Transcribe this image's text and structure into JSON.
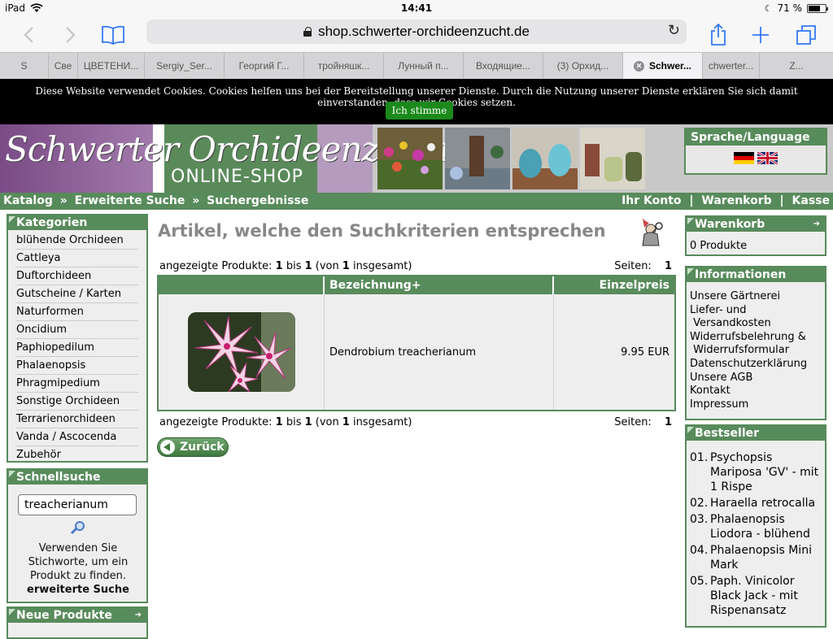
{
  "status_bar": {
    "device": "iPad",
    "time": "14:41",
    "battery": "71 %",
    "battery_level": 0.71
  },
  "toolbar": {
    "url": "shop.schwerter-orchideenzucht.de"
  },
  "tabs": [
    {
      "label": "S",
      "active": false
    },
    {
      "label": "Све",
      "active": false
    },
    {
      "label": "ЦВЕТЕНИ...",
      "active": false
    },
    {
      "label": "Sergiy_Ser...",
      "active": false
    },
    {
      "label": "Георгий Г...",
      "active": false
    },
    {
      "label": "тройняшк...",
      "active": false
    },
    {
      "label": "Лунный п...",
      "active": false
    },
    {
      "label": "Входящие...",
      "active": false
    },
    {
      "label": "(3) Орхид...",
      "active": false
    },
    {
      "label": "Schwer...",
      "active": true
    },
    {
      "label": "chwerter...",
      "active": false
    },
    {
      "label": "Z...",
      "active": false
    }
  ],
  "cookie": {
    "message": "Diese Website verwendet Cookies. Cookies helfen uns bei der Bereitstellung unserer Dienste. Durch die Nutzung unserer Dienste erklären Sie sich damit einverstanden, dass wir Cookies setzen.",
    "button": "Ich stimme zu"
  },
  "banner": {
    "logo_text": "Schwerter Orchideenzucht",
    "logo_sub": "ONLINE-SHOP"
  },
  "language": {
    "title": "Sprache/Language"
  },
  "breadcrumb": {
    "items": [
      "Katalog",
      "Erweiterte Suche",
      "Suchergebnisse"
    ],
    "separator": "»",
    "right": [
      "Ihr Konto",
      "Warenkorb",
      "Kasse"
    ],
    "right_separator": "|"
  },
  "sidebar_left": {
    "categories_title": "Kategorien",
    "categories": [
      "blühende Orchideen",
      "Cattleya",
      "Duftorchideen",
      "Gutscheine / Karten",
      "Naturformen",
      "Oncidium",
      "Paphiopedilum",
      "Phalaenopsis",
      "Phragmipedium",
      "Sonstige Orchideen",
      "Terrarienorchideen",
      "Vanda / Ascocenda",
      "Zubehör"
    ],
    "quick_search_title": "Schnellsuche",
    "search_value": "treacherianum",
    "search_help": "Verwenden Sie Stichworte, um ein Produkt zu finden.",
    "advanced_search": "erweiterte Suche",
    "new_products_title": "Neue Produkte"
  },
  "main": {
    "heading": "Artikel, welche den Suchkriterien entsprechen",
    "count": {
      "label": "angezeigte Produkte:",
      "from": "1",
      "to_word": "bis",
      "to": "1",
      "of_word": "(von",
      "total": "1",
      "of_end": "insgesamt)",
      "pages_label": "Seiten:",
      "pages": "1"
    },
    "table": {
      "headers": [
        "",
        "Bezeichnung+",
        "Einzelpreis"
      ],
      "rows": [
        {
          "name": "Dendrobium treacherianum",
          "price": "9.95 EUR"
        }
      ]
    },
    "back_button": "Zurück"
  },
  "sidebar_right": {
    "cart_title": "Warenkorb",
    "cart_content": "0 Produkte",
    "info_title": "Informationen",
    "info_links": [
      "Unsere Gärtnerei",
      "Liefer- und",
      " Versandkosten",
      "Widerrufsbelehrung &",
      " Widerrufsformular",
      "Datenschutzerklärung",
      "Unsere AGB",
      "Kontakt",
      "Impressum"
    ],
    "bestseller_title": "Bestseller",
    "bestsellers": [
      {
        "n": "01.",
        "name": "Psychopsis Mariposa 'GV' - mit 1 Rispe"
      },
      {
        "n": "02.",
        "name": "Haraella retrocalla"
      },
      {
        "n": "03.",
        "name": "Phalaenopsis Liodora - blühend"
      },
      {
        "n": "04.",
        "name": "Phalaenopsis Mini Mark"
      },
      {
        "n": "05.",
        "name": "Paph. Vinicolor Black Jack - mit Rispenansatz"
      }
    ]
  },
  "colors": {
    "green": "#588b5b",
    "ios_blue": "#3478f6",
    "cookie_bg": "#000000",
    "cookie_btn": "#1b8a1b"
  }
}
